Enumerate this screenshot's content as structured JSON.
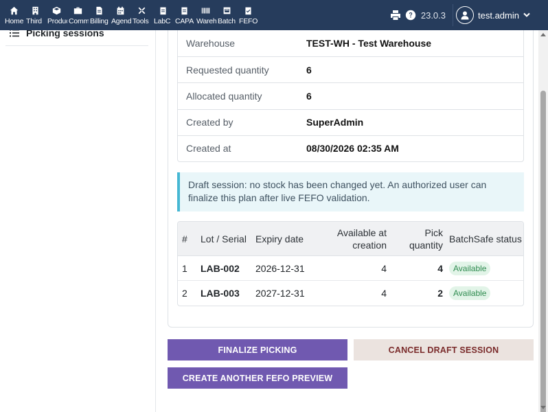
{
  "nav": {
    "items": [
      {
        "label": "Home",
        "icon": "home-icon"
      },
      {
        "label": "Third",
        "icon": "building-icon"
      },
      {
        "label": "Products",
        "icon": "cube-icon"
      },
      {
        "label": "Commerce",
        "icon": "briefcase-icon"
      },
      {
        "label": "Billing",
        "icon": "invoice-icon"
      },
      {
        "label": "Agenda",
        "icon": "calendar-icon"
      },
      {
        "label": "Tools",
        "icon": "tools-icon"
      },
      {
        "label": "LabC",
        "icon": "clipboard-icon"
      },
      {
        "label": "CAPA",
        "icon": "clipboard-icon"
      },
      {
        "label": "Warehouse",
        "icon": "barcode-icon"
      },
      {
        "label": "Batch",
        "icon": "batch-icon"
      },
      {
        "label": "FEFO",
        "icon": "clipboard-check-icon"
      }
    ],
    "version": "23.0.3",
    "username": "test.admin"
  },
  "sidebar": {
    "item_label": "Picking sessions"
  },
  "details": {
    "rows": [
      {
        "label": "Warehouse",
        "value": "TEST-WH - Test Warehouse"
      },
      {
        "label": "Requested quantity",
        "value": "6"
      },
      {
        "label": "Allocated quantity",
        "value": "6"
      },
      {
        "label": "Created by",
        "value": "SuperAdmin"
      },
      {
        "label": "Created at",
        "value": "08/30/2026 02:35 AM"
      }
    ]
  },
  "alert": {
    "text": "Draft session: no stock has been changed yet. An authorized user can finalize this plan after live FEFO validation."
  },
  "lots_table": {
    "headers": {
      "num": "#",
      "lot": "Lot / Serial",
      "expiry": "Expiry date",
      "available": "Available at creation",
      "pick": "Pick quantity",
      "status": "BatchSafe status"
    },
    "rows": [
      {
        "num": "1",
        "lot": "LAB-002",
        "expiry": "2026-12-31",
        "available": "4",
        "pick": "4",
        "status": "Available"
      },
      {
        "num": "2",
        "lot": "LAB-003",
        "expiry": "2027-12-31",
        "available": "4",
        "pick": "2",
        "status": "Available"
      }
    ]
  },
  "actions": {
    "finalize": "FINALIZE PICKING",
    "cancel": "CANCEL DRAFT SESSION",
    "another": "CREATE ANOTHER FEFO PREVIEW"
  },
  "colors": {
    "topbar": "#263c5c",
    "primary_button": "#7059b0",
    "secondary_button": "#ebe3df",
    "alert_border": "#46b7d3",
    "badge_text": "#2e8b4f"
  }
}
